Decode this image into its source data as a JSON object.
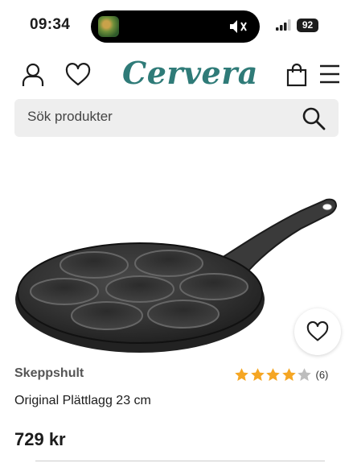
{
  "status_bar": {
    "time": "09:34",
    "battery": "92"
  },
  "header": {
    "logo": "Cervera",
    "icons": [
      "account-icon",
      "favorites-icon",
      "cart-icon",
      "menu-icon"
    ]
  },
  "search": {
    "placeholder": "Sök produkter"
  },
  "product": {
    "brand": "Skeppshult",
    "rating": {
      "stars": 4,
      "max": 5,
      "count_label": "(6)"
    },
    "title": "Original Plättlagg 23 cm",
    "price": "729 kr"
  },
  "colors": {
    "brand": "#2f7b78",
    "star": "#f5a623",
    "star_empty": "#bdbdbd",
    "search_bg": "#eeeeee"
  }
}
